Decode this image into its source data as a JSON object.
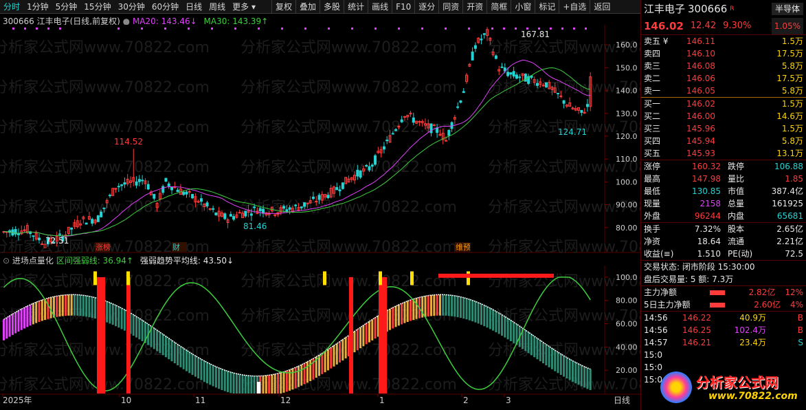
{
  "toolbar": {
    "left_tabs": [
      "分时",
      "1分钟",
      "5分钟",
      "15分钟",
      "30分钟",
      "60分钟",
      "日线",
      "周线",
      "更多"
    ],
    "right_tabs": [
      "复权",
      "叠加",
      "多股",
      "统计",
      "画线",
      "F10",
      "逐分",
      "同资",
      "开资",
      "简框",
      "小窗",
      "标记",
      "+自选",
      "返回"
    ]
  },
  "chart": {
    "code_name": "300666 江丰电子(日线,前复权)",
    "ma20": "MA20: 143.46↓",
    "ma30": "MA30: 143.39↑",
    "high_label": "167.81",
    "peak_label": "114.52",
    "low_label_1": "72.51",
    "low_label_2": "81.46",
    "low_label_3": "124.71",
    "y_ticks": [
      "160.0",
      "150.0",
      "140.0",
      "130.0",
      "120.0",
      "110.0",
      "100.0",
      "90.00",
      "80.00"
    ],
    "event_tags": [
      "涨榜",
      "财",
      "维预"
    ],
    "watermark": "分析家公式网www.70822.com"
  },
  "indicator": {
    "name": "进场点量化",
    "line1": "区间强弱线: 36.94↑",
    "line2": "强弱趋势平均线: 43.50↓",
    "y_ticks": [
      "100.0",
      "80.00",
      "60.00",
      "40.00",
      "20.00"
    ]
  },
  "xaxis": {
    "labels": [
      "2025年",
      "10",
      "11",
      "12",
      "1",
      "2",
      "3"
    ],
    "period": "日线"
  },
  "side": {
    "title": "江丰电子",
    "code": "300666",
    "badge": "R",
    "sector": "半导体",
    "price": "146.02",
    "change": "12.42",
    "pct": "9.30%",
    "pct2": "1.05%",
    "asks": [
      {
        "label": "卖五",
        "price": "146.11",
        "vol": "1.5万",
        "mark": "¥"
      },
      {
        "label": "卖四",
        "price": "146.10",
        "vol": "17.5万"
      },
      {
        "label": "卖三",
        "price": "146.08",
        "vol": "5.8万"
      },
      {
        "label": "卖二",
        "price": "146.06",
        "vol": "17.5万"
      },
      {
        "label": "卖一",
        "price": "146.05",
        "vol": "5.8万"
      }
    ],
    "bids": [
      {
        "label": "买一",
        "price": "146.02",
        "vol": "1.5万"
      },
      {
        "label": "买二",
        "price": "146.00",
        "vol": "14.6万"
      },
      {
        "label": "买三",
        "price": "145.96",
        "vol": "1.5万"
      },
      {
        "label": "买四",
        "price": "145.94",
        "vol": "5.8万"
      },
      {
        "label": "买五",
        "price": "145.93",
        "vol": "13.1万"
      }
    ],
    "stats": [
      [
        "涨停",
        "160.32",
        "跌停",
        "106.88"
      ],
      [
        "最高",
        "147.98",
        "量比",
        "1.85"
      ],
      [
        "最低",
        "130.85",
        "市值",
        "387.4亿"
      ],
      [
        "现量",
        "2158",
        "总量",
        "161925"
      ],
      [
        "外盘",
        "96244",
        "内盘",
        "65681"
      ]
    ],
    "stats2": [
      [
        "换手",
        "7.32%",
        "股本",
        "2.65亿"
      ],
      [
        "净资",
        "18.64",
        "流通",
        "2.21亿"
      ],
      [
        "收益(≡)",
        "1.510",
        "PE(动)",
        "72.5"
      ]
    ],
    "trade_status": "交易状态: 闭市阶段 15:30:00",
    "after_hours": "盘后交易量: 5  额: 7.3万",
    "main_net": {
      "label": "主力净额",
      "value": "2.82亿",
      "pct": "12%"
    },
    "main_net5": {
      "label": "5日主力净额",
      "value": "2.60亿",
      "pct": "4%"
    },
    "ticks": [
      {
        "time": "14:56",
        "price": "146.22",
        "vol": "40.9万",
        "side": "B"
      },
      {
        "time": "14:56",
        "price": "146.25",
        "vol": "102.4万",
        "side": "B"
      },
      {
        "time": "14:57",
        "price": "146.21",
        "vol": "23.4万",
        "side": "S"
      },
      {
        "time": "15:0"
      },
      {
        "time": "15:0"
      },
      {
        "time": "15:0"
      }
    ],
    "logo_text": "分析家公式网",
    "logo_url": "www.70822.com"
  },
  "colors": {
    "up": "#ff3b3b",
    "down": "#25d4d4",
    "ma20": "#e040fb",
    "ma30": "#3ecf3e"
  }
}
